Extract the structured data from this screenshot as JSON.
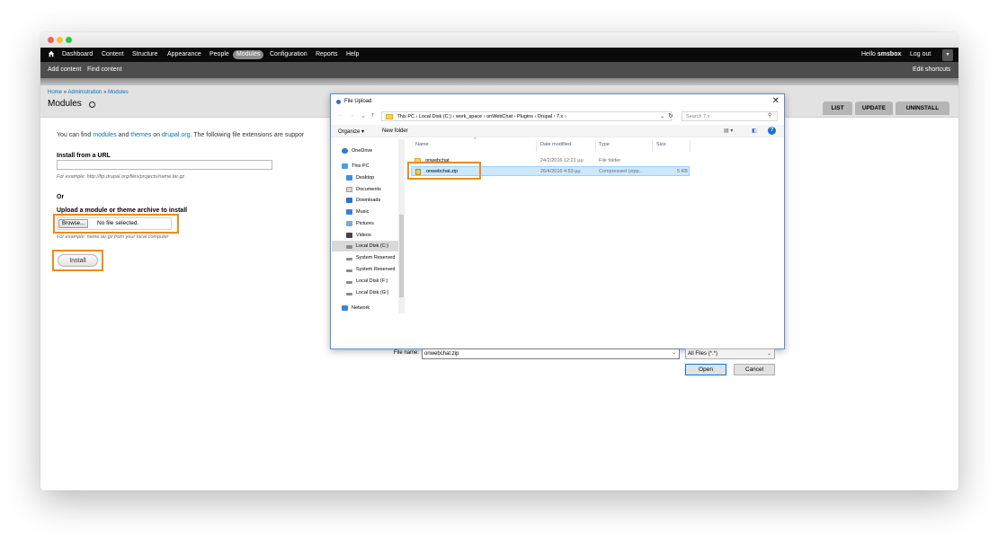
{
  "toolbar": {
    "home_icon": "home-icon",
    "items": [
      "Dashboard",
      "Content",
      "Structure",
      "Appearance",
      "People",
      "Modules",
      "Configuration",
      "Reports",
      "Help"
    ],
    "active_item": "Modules",
    "greeting": "Hello",
    "username": "smsbox",
    "logout": "Log out"
  },
  "shortcuts": {
    "items": [
      "Add content",
      "Find content"
    ],
    "edit": "Edit shortcuts"
  },
  "breadcrumb": {
    "home": "Home",
    "sep": "»",
    "admin": "Administration",
    "modules": "Modules"
  },
  "page": {
    "title": "Modules",
    "tabs": [
      "LIST",
      "UPDATE",
      "UNINSTALL"
    ]
  },
  "form": {
    "intro_prefix": "You can find",
    "intro_modules": "modules",
    "intro_and": "and",
    "intro_themes": "themes",
    "intro_on": "on",
    "intro_site": "drupal.org",
    "intro_suffix": ". The following file extensions are suppor",
    "url_label": "Install from a URL",
    "url_example": "For example: http://ftp.drupal.org/files/projects/name.tar.gz",
    "or": "Or",
    "upload_label": "Upload a module or theme archive to install",
    "browse_label": "Browse...",
    "no_file": "No file selected.",
    "upload_example": "For example: name.tar.gz from your local computer",
    "install_label": "Install"
  },
  "dialog": {
    "title": "File Upload",
    "close": "✕",
    "address_path": [
      "This PC",
      "Local Disk (C:)",
      "work_space",
      "onWebChat",
      "Plugins",
      "Drupal",
      "7.x"
    ],
    "search_placeholder": "Search 7.x",
    "organize": "Organize ▾",
    "new_folder": "New folder",
    "nav": [
      {
        "label": "OneDrive",
        "icon": "onedrive-icon"
      },
      {
        "label": "This PC",
        "icon": "computer-icon"
      },
      {
        "label": "Desktop",
        "icon": "desktop-icon"
      },
      {
        "label": "Documents",
        "icon": "documents-icon"
      },
      {
        "label": "Downloads",
        "icon": "downloads-icon"
      },
      {
        "label": "Music",
        "icon": "music-icon"
      },
      {
        "label": "Pictures",
        "icon": "pictures-icon"
      },
      {
        "label": "Videos",
        "icon": "videos-icon"
      },
      {
        "label": "Local Disk (C:)",
        "icon": "drive-icon"
      },
      {
        "label": "System Reserved",
        "icon": "drive-icon"
      },
      {
        "label": "System Reserved",
        "icon": "drive-icon"
      },
      {
        "label": "Local Disk (F:)",
        "icon": "drive-icon"
      },
      {
        "label": "Local Disk (G:)",
        "icon": "drive-icon"
      },
      {
        "label": "Network",
        "icon": "network-icon"
      }
    ],
    "columns": [
      "Name",
      "Date modified",
      "Type",
      "Size"
    ],
    "files": [
      {
        "name": "onwebchat",
        "date": "24/2/2016 12:21 μμ",
        "type": "File folder",
        "size": ""
      },
      {
        "name": "onwebchat.zip",
        "date": "26/4/2016 4:53 μμ",
        "type": "Compressed (zipp...",
        "size": "5 KB"
      }
    ],
    "filename_label": "File name:",
    "filename_value": "onwebchat.zip",
    "filetype_value": "All Files (*.*)",
    "open_label": "Open",
    "cancel_label": "Cancel"
  },
  "colors": {
    "highlight": "#f08a1c",
    "link": "#0074bd",
    "selection": "#cce8ff"
  }
}
